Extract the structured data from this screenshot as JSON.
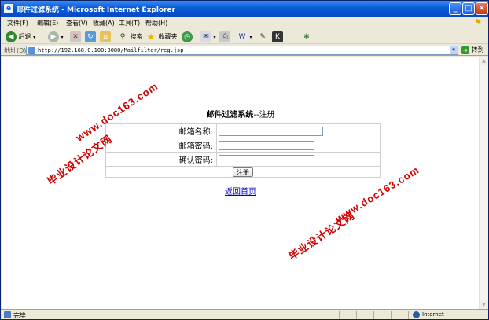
{
  "window": {
    "title": "邮件过滤系统 - Microsoft Internet Explorer",
    "minimize_glyph": "_",
    "maximize_glyph": "□",
    "close_glyph": "×"
  },
  "menu": {
    "items": [
      "文件(F)",
      "编辑(E)",
      "查看(V)",
      "收藏(A)",
      "工具(T)",
      "帮助(H)"
    ]
  },
  "toolbar": {
    "back_label": "后退",
    "search_label": "搜索",
    "favorites_label": "收藏夹"
  },
  "address": {
    "label": "地址(D)",
    "url": "http://192.168.0.100:8080/Mailfilter/reg.jsp",
    "go_label": "转到"
  },
  "page": {
    "title_bold": "邮件过滤系统",
    "title_rest": "--注册",
    "form": {
      "email_label": "邮箱名称:",
      "password_label": "邮箱密码:",
      "confirm_label": "确认密码:",
      "email_value": "",
      "password_value": "",
      "confirm_value": "",
      "submit_label": "注册"
    },
    "home_link": "返回首页"
  },
  "watermark": {
    "site": "www.doc163.com",
    "text": "毕业设计论文网"
  },
  "status": {
    "text": "完毕",
    "zone": "Internet"
  },
  "colors": {
    "titlebar": "#0a5fd8",
    "watermark": "#d00000",
    "link": "#0000cc"
  }
}
